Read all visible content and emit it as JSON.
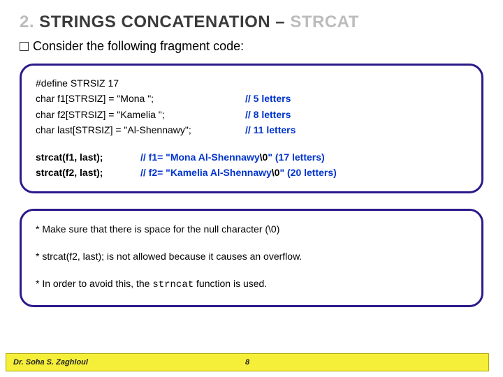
{
  "title": {
    "num": "2.",
    "main": " STRINGS CONCATENATION – ",
    "strcat": "STRCAT"
  },
  "subtitle": "Consider the following fragment code:",
  "code": {
    "l1": "#define STRSIZ 17",
    "l2a": "char f1[STRSIZ] = \"Mona \";",
    "l2b": "// 5 letters",
    "l3a": "char f2[STRSIZ] = \"Kamelia \";",
    "l3b": "// 8 letters",
    "l4a": "char last[STRSIZ] = \"Al-Shennawy\";",
    "l4b": "// 11 letters",
    "s1a": "strcat(f1, last);",
    "s1b_pre": "// f1= \"Mona Al-Shennawy",
    "s1b_mid": "\\0",
    "s1b_post": "\"    (17 letters)",
    "s2a": "strcat(f2, last);",
    "s2b_pre": "// f2= \"Kamelia Al-Shennawy",
    "s2b_mid": "\\0",
    "s2b_post": "\" (20 letters)"
  },
  "notes": {
    "n1": "* Make sure that there is space for the null character (\\0)",
    "n2": "* strcat(f2, last);  is not allowed because it causes an overflow.",
    "n3_pre": "* In order to avoid this, the ",
    "n3_code": "strncat",
    "n3_post": " function is used."
  },
  "footer": {
    "name": "Dr. Soha S. Zaghloul",
    "page": "8"
  }
}
